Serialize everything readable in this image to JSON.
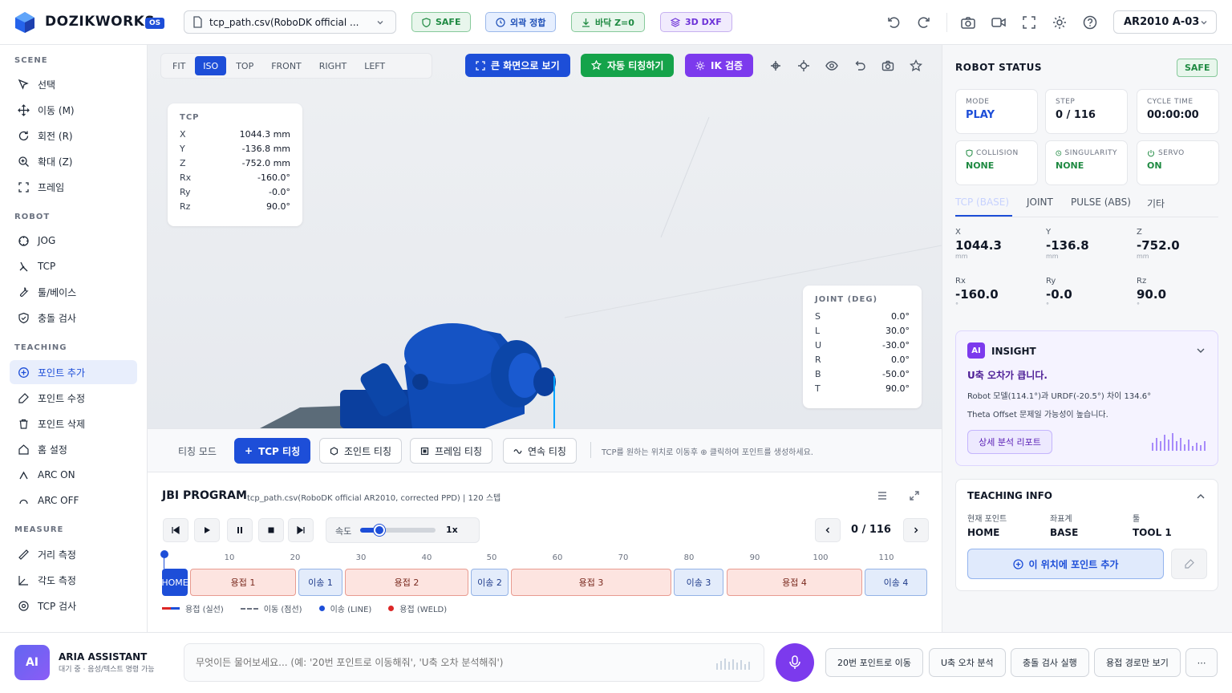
{
  "topbar": {
    "brand": "DOZIKWORKS",
    "version": "OS",
    "file": "tcp_path.csv(RoboDK official ...",
    "chips": {
      "safe": "SAFE",
      "ext": "외곽 정합",
      "floor": "바닥 Z=0",
      "dxf": "3D DXF"
    },
    "robot": "AR2010 A-03"
  },
  "sidebar": {
    "scene_title": "SCENE",
    "scene": [
      "선택",
      "이동 (M)",
      "회전 (R)",
      "확대 (Z)",
      "프레임"
    ],
    "robot_title": "ROBOT",
    "robot": [
      "JOG",
      "TCP",
      "툴/베이스",
      "충돌 검사"
    ],
    "teaching_title": "TEACHING",
    "teaching": [
      "포인트 추가",
      "포인트 수정",
      "포인트 삭제",
      "홈 설정",
      "ARC ON",
      "ARC OFF"
    ],
    "measure_title": "MEASURE",
    "measure": [
      "거리 측정",
      "각도 측정",
      "TCP 검사"
    ]
  },
  "viewport": {
    "views": [
      "FIT",
      "ISO",
      "TOP",
      "FRONT",
      "RIGHT",
      "LEFT"
    ],
    "fullscreen": "큰 화면으로 보기",
    "auto_teach": "자동 티칭하기",
    "ik_check": "IK 검증",
    "tcp": {
      "title": "TCP",
      "rows": [
        {
          "k": "X",
          "v": "1044.3 mm"
        },
        {
          "k": "Y",
          "v": "-136.8 mm"
        },
        {
          "k": "Z",
          "v": "-752.0 mm"
        },
        {
          "k": "Rx",
          "v": "-160.0°"
        },
        {
          "k": "Ry",
          "v": "-0.0°"
        },
        {
          "k": "Rz",
          "v": "90.0°"
        }
      ]
    },
    "joint": {
      "title": "JOINT (DEG)",
      "rows": [
        {
          "k": "S",
          "v": "0.0°"
        },
        {
          "k": "L",
          "v": "30.0°"
        },
        {
          "k": "U",
          "v": "-30.0°"
        },
        {
          "k": "R",
          "v": "0.0°"
        },
        {
          "k": "B",
          "v": "-50.0°"
        },
        {
          "k": "T",
          "v": "90.0°"
        }
      ]
    }
  },
  "teach_mode": {
    "label": "티칭 모드",
    "buttons": [
      "TCP 티칭",
      "조인트 티칭",
      "프레임 티칭",
      "연속 티칭"
    ],
    "hint": "TCP를 원하는 위치로 이동후 ⊕ 클릭하여 포인트를 생성하세요."
  },
  "program": {
    "title": "JBI PROGRAM",
    "subtitle": "tcp_path.csv(RoboDK official AR2010, corrected PPD) | 120 스텝",
    "speed_label": "속도",
    "speed_value": "1x",
    "speed_fraction": 0.25,
    "step": "0 / 116",
    "ticks": [
      "10",
      "20",
      "30",
      "40",
      "50",
      "60",
      "70",
      "80",
      "90",
      "100",
      "110"
    ],
    "segments": [
      {
        "label": "HOME",
        "kind": "home"
      },
      {
        "label": "용접 1",
        "kind": "weld"
      },
      {
        "label": "이송 1",
        "kind": "move"
      },
      {
        "label": "용접 2",
        "kind": "weld"
      },
      {
        "label": "이송 2",
        "kind": "move"
      },
      {
        "label": "용접 3",
        "kind": "weld"
      },
      {
        "label": "이송 3",
        "kind": "move"
      },
      {
        "label": "용접 4",
        "kind": "weld"
      },
      {
        "label": "이송 4",
        "kind": "move"
      }
    ],
    "legend": [
      "용접 (실선)",
      "이동 (점선)",
      "이송 (LINE)",
      "용접 (WELD)"
    ]
  },
  "status": {
    "title": "ROBOT STATUS",
    "badge": "SAFE",
    "cards": [
      {
        "label": "MODE",
        "value": "PLAY",
        "color": "#1d4ed8"
      },
      {
        "label": "STEP",
        "value": "0 / 116",
        "color": "#111827"
      },
      {
        "label": "CYCLE TIME",
        "value": "00:00:00",
        "color": "#111827"
      },
      {
        "label": "COLLISION",
        "value": "NONE",
        "color": "#1f8a42"
      },
      {
        "label": "SINGULARITY",
        "value": "NONE",
        "color": "#1f8a42"
      },
      {
        "label": "SERVO",
        "value": "ON",
        "color": "#1f8a42"
      }
    ],
    "tabs": [
      "TCP (BASE)",
      "JOINT",
      "PULSE (ABS)",
      "기타"
    ],
    "coords": [
      {
        "label": "X",
        "value": "1044.3",
        "unit": "mm"
      },
      {
        "label": "Y",
        "value": "-136.8",
        "unit": "mm"
      },
      {
        "label": "Z",
        "value": "-752.0",
        "unit": "mm"
      },
      {
        "label": "Rx",
        "value": "-160.0",
        "unit": "°"
      },
      {
        "label": "Ry",
        "value": "-0.0",
        "unit": "°"
      },
      {
        "label": "Rz",
        "value": "90.0",
        "unit": "°"
      }
    ]
  },
  "insight": {
    "badge": "AI",
    "title": "INSIGHT",
    "headline": "U축 오차가 큽니다.",
    "line1": "Robot 모델(114.1°)과 URDF(-20.5°) 차이 134.6°",
    "line2": "Theta Offset 문제일 가능성이 높습니다.",
    "button": "상세 분석 리포트"
  },
  "teaching_info": {
    "title": "TEACHING INFO",
    "cols": [
      {
        "label": "현재 포인트",
        "value": "HOME"
      },
      {
        "label": "좌표계",
        "value": "BASE"
      },
      {
        "label": "툴",
        "value": "TOOL 1"
      }
    ],
    "add_button": "이 위치에 포인트 추가"
  },
  "assistant": {
    "avatar": "AI",
    "name": "ARIA ASSISTANT",
    "status": "대기 중 · 음성/텍스트 명령 가능",
    "placeholder": "무엇이든 물어보세요... (예: '20번 포인트로 이동해줘', 'U축 오차 분석해줘')",
    "quick": [
      "20번 포인트로 이동",
      "U축 오차 분석",
      "충돌 검사 실행",
      "용접 경로만 보기"
    ],
    "more": "⋯"
  }
}
